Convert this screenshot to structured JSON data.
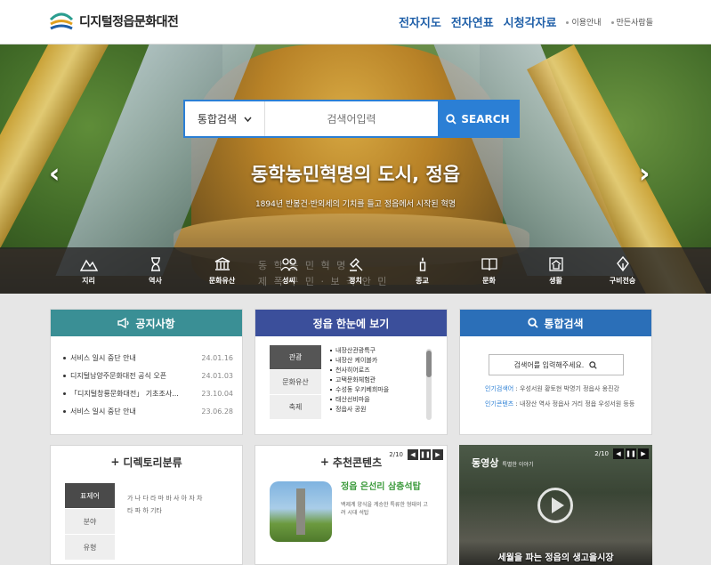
{
  "header": {
    "logo_text": "디지털정읍문화대전",
    "nav": [
      "전자지도",
      "전자연표",
      "시청각자료"
    ],
    "sub_links": [
      "이용안내",
      "만든사람들"
    ]
  },
  "hero": {
    "search_select": "통합검색",
    "search_placeholder": "검색어입력",
    "search_button": "SEARCH",
    "headline": "동학농민혁명의 도시, 정읍",
    "subline": "1894년 반봉건·반외세의 기치를 들고 정읍에서 시작된 혁명",
    "watermark_1": "동 학 농 민 혁 명",
    "watermark_2": "제 폭 구 민 · 보 국 안 민",
    "categories": [
      "지리",
      "역사",
      "문화유산",
      "성씨",
      "정치",
      "종교",
      "문화",
      "생활",
      "구비전승"
    ]
  },
  "notice": {
    "title": "공지사항",
    "color": "#3a8f95",
    "items": [
      {
        "text": "서비스 일시 중단 안내",
        "date": "24.01.16"
      },
      {
        "text": "디지털남양주문화대전 공식 오픈",
        "date": "24.01.03"
      },
      {
        "text": "「디지털창룡문화대전」 기초조사...",
        "date": "23.10.04"
      },
      {
        "text": "서비스 일시 중단 안내",
        "date": "23.06.28"
      }
    ]
  },
  "glance": {
    "title": "정읍 한눈에 보기",
    "color": "#3b4f9b",
    "tabs": [
      "관광",
      "문화유산",
      "축제"
    ],
    "items": [
      "내장산관광특구",
      "내장산 케이블카",
      "천사히어로즈",
      "고택문화체험관",
      "수성동 우키베희마을",
      "태산선비마을",
      "정읍사 공원"
    ]
  },
  "integrated": {
    "title": "통합검색",
    "color": "#2b6fb8",
    "placeholder": "검색어를 입력해주세요.",
    "popular_label": "인기검색어",
    "popular_values": "우성서원 황토현 박명기 정읍사 옹진강",
    "content_label": "인기콘텐츠",
    "content_values": "내장산 역사 정읍사 거리 정읍 우성서원 등등"
  },
  "directory": {
    "title": "디렉토리분류",
    "tabs": [
      "표제어",
      "분야",
      "유형"
    ],
    "letters": "가 나 다 라 마 바 사 아 자 차 타 파 하 기타"
  },
  "recommend": {
    "title": "추천콘텐츠",
    "page": "2/10",
    "item_title": "정읍 은선리 삼층석탑",
    "item_desc": "백제계 양식을 계승한 특류한 형태의 고려 시대 석탑"
  },
  "video": {
    "label": "동영상",
    "sublabel": "특별한 이야기",
    "page": "2/10",
    "caption": "세월을 파는 정읍의 생고을시장"
  }
}
